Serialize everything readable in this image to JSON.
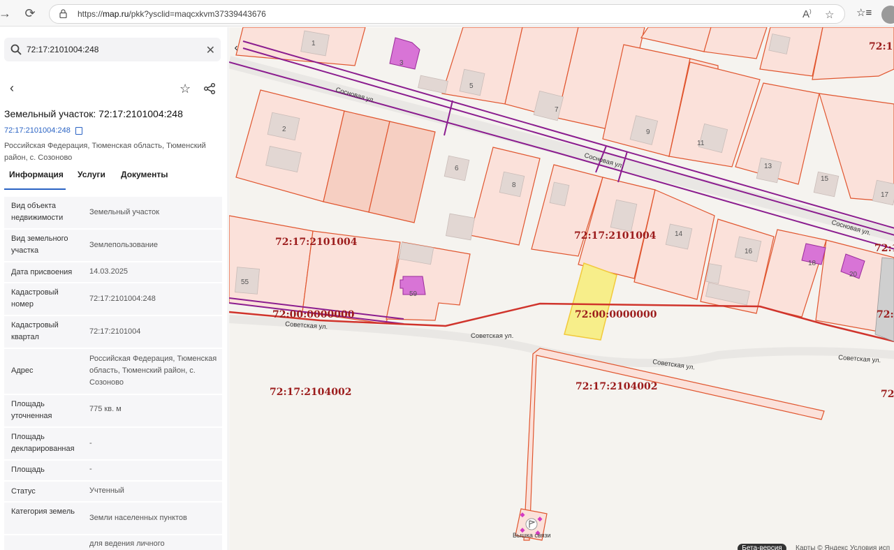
{
  "browser": {
    "url_prefix": "https://",
    "url_domain": "map.ru",
    "url_path": "/pkk?ysclid=maqcxkvm37339443676"
  },
  "search": {
    "value": "72:17:2101004:248"
  },
  "object": {
    "title": "Земельный участок: 72:17:2101004:248",
    "cad_number": "72:17:2101004:248",
    "address": "Российская Федерация, Тюменская область, Тюменский район, с. Созоново"
  },
  "tabs": [
    "Информация",
    "Услуги",
    "Документы"
  ],
  "info_rows": [
    {
      "label": "Вид объекта недвижимости",
      "value": "Земельный участок"
    },
    {
      "label": "Вид земельного участка",
      "value": "Землепользование"
    },
    {
      "label": "Дата присвоения",
      "value": "14.03.2025"
    },
    {
      "label": "Кадастровый номер",
      "value": "72:17:2101004:248"
    },
    {
      "label": "Кадастровый квартал",
      "value": "72:17:2101004"
    },
    {
      "label": "Адрес",
      "value": "Российская Федерация, Тюменская область, Тюменский район, с. Созоново"
    },
    {
      "label": "Площадь уточненная",
      "value": "775 кв. м"
    },
    {
      "label": "Площадь декларированная",
      "value": "-"
    },
    {
      "label": "Площадь",
      "value": "-"
    },
    {
      "label": "Статус",
      "value": "Учтенный"
    },
    {
      "label": "Категория земель",
      "value": "Земли населенных пунктов"
    },
    {
      "label": "",
      "value": "для ведения личного"
    }
  ],
  "map": {
    "streets": {
      "sosnovaya": "Сосновая ул.",
      "sovetskaya": "Советская ул."
    },
    "cad_labels": {
      "q1": "72:17:2101004",
      "q2": "72:00:0000000",
      "q3": "72:17:2104002",
      "edge1": "72:1",
      "edge2": "72:1",
      "edge3": "72:",
      "edge4": "72"
    },
    "house_numbers": [
      "1",
      "3",
      "5",
      "7",
      "9",
      "11",
      "13",
      "15",
      "17",
      "2",
      "6",
      "8",
      "14",
      "16",
      "18",
      "20",
      "55",
      "59"
    ],
    "tower_label": "Вышка связи",
    "beta": "Бета-версия",
    "copyright": "Карты © Яндекс   Условия исп"
  },
  "colors": {
    "accent": "#2a63c4",
    "parcel_fill": "#fbe1da",
    "parcel_stroke": "#e0552e",
    "selected_fill": "#f7ee8a",
    "building_fill": "#d874d6",
    "boundary_purple": "#8b1d8f",
    "cad_label": "#9b1b1b"
  }
}
